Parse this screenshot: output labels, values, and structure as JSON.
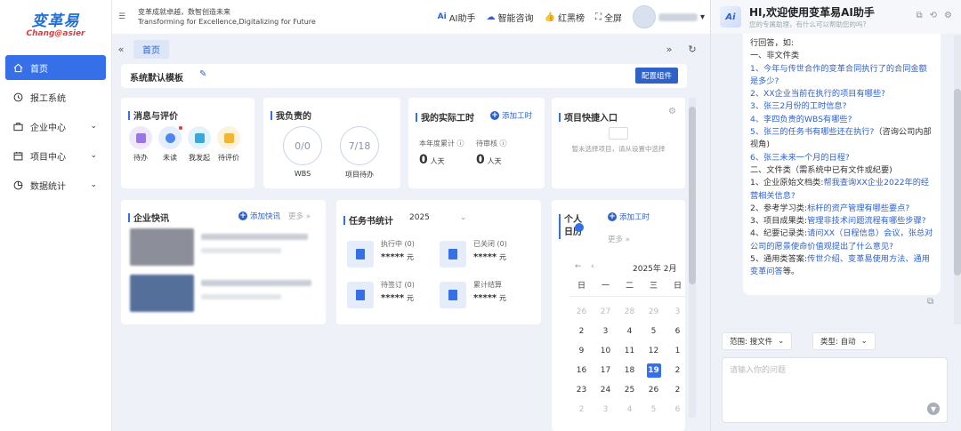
{
  "logo": {
    "main": "变革易",
    "sub": "Chang@asier"
  },
  "sidebar": {
    "items": [
      {
        "label": "首页",
        "icon": "home-icon"
      },
      {
        "label": "报工系统",
        "icon": "clock-icon"
      },
      {
        "label": "企业中心",
        "icon": "briefcase-icon"
      },
      {
        "label": "项目中心",
        "icon": "calendar-icon"
      },
      {
        "label": "数据统计",
        "icon": "chart-icon"
      }
    ]
  },
  "topbar": {
    "slogan_cn": "变革成就卓越，数智创造未来",
    "slogan_en": "Transforming for Excellence,Digitalizing for Future",
    "ai_assistant": "AI助手",
    "smart_consult": "智能咨询",
    "ranking": "红黑榜",
    "fullscreen": "全屏"
  },
  "tabs": {
    "home": "首页"
  },
  "template": {
    "title": "系统默认模板",
    "config_button": "配置组件"
  },
  "messages": {
    "title": "消息与评价",
    "items": [
      "待办",
      "未读",
      "我发起",
      "待评价"
    ]
  },
  "mine": {
    "title": "我负责的",
    "wbs_value": "0/0",
    "wbs_label": "WBS",
    "proj_value": "7/18",
    "proj_label": "项目待办"
  },
  "worktime": {
    "title": "我的实际工时",
    "add": "添加工时",
    "year_label": "本年度累计",
    "pending_label": "待审核",
    "year_value": "0",
    "pending_value": "0",
    "unit": "人天"
  },
  "quick": {
    "title": "项目快捷入口",
    "empty": "暂未选择项目，请从设置中选择"
  },
  "news": {
    "title": "企业快讯",
    "add": "添加快讯",
    "more": "更多"
  },
  "tasks": {
    "title": "任务书统计",
    "year": "2025",
    "items": [
      {
        "label": "执行中 (0)",
        "value": "*****",
        "unit": "元"
      },
      {
        "label": "已关闭 (0)",
        "value": "*****",
        "unit": "元"
      },
      {
        "label": "待签订 (0)",
        "value": "*****",
        "unit": "元"
      },
      {
        "label": "累计结算",
        "value": "*****",
        "unit": "元"
      }
    ]
  },
  "calendar": {
    "title": "个人日历",
    "add": "添加工时",
    "more": "更多",
    "month": "2025年 2月",
    "weekdays": [
      "日",
      "一",
      "二",
      "三",
      "日"
    ],
    "rows": [
      [
        "26",
        "27",
        "28",
        "29",
        "3"
      ],
      [
        "2",
        "3",
        "4",
        "5",
        "6"
      ],
      [
        "9",
        "10",
        "11",
        "12",
        "1"
      ],
      [
        "16",
        "17",
        "18",
        "19",
        "2"
      ],
      [
        "23",
        "24",
        "25",
        "26",
        "2"
      ],
      [
        "2",
        "3",
        "4",
        "5",
        "6"
      ]
    ],
    "today": "19"
  },
  "ai": {
    "title": "HI,欢迎使用变革易AI助手",
    "subtitle": "您的专属助理，有什么可以帮助您的吗?",
    "lines": [
      {
        "t": "行回答，如:",
        "q": false
      },
      {
        "t": "一、非文件类",
        "q": false
      },
      {
        "t": "1、今年与传世合作的变革合同执行了的合同金额是多少?",
        "q": true,
        "pre": "1、"
      },
      {
        "t": "2、XX企业当前在执行的项目有哪些?",
        "q": true
      },
      {
        "t": "3、张三2月份的工时信息?",
        "q": true
      },
      {
        "t": "4、李四负责的WBS有哪些?",
        "q": true
      },
      {
        "t": "5、张三的任务书有哪些还在执行?",
        "q": true,
        "tail": "（咨询公司内部视角)"
      },
      {
        "t": "6、张三未来一个月的日程?",
        "q": true
      },
      {
        "t": "二、文件类（需系统中已有文件或纪要)",
        "q": false
      }
    ],
    "file_lines": [
      {
        "k": "1、企业原始文档类:",
        "v": "帮我查询XX企业2022年的经营相关信息?"
      },
      {
        "k": "2、参考学习类:",
        "v": "标杆的资产管理有哪些要点?"
      },
      {
        "k": "3、项目成果类:",
        "v": "管理非技术问题流程有哪些步骤?"
      },
      {
        "k": "4、纪要记录类:",
        "v": "请问XX（日程信息）会议，张总对公司的愿景使命价值观提出了什么意见?"
      },
      {
        "k": "5、通用类答案:",
        "v": "传世介绍、变革易使用方法、通用变革问答",
        "tail": "等。"
      }
    ],
    "scope_label": "范围: 搜文件",
    "type_label": "类型: 自动",
    "input_placeholder": "请输入你的问题"
  }
}
